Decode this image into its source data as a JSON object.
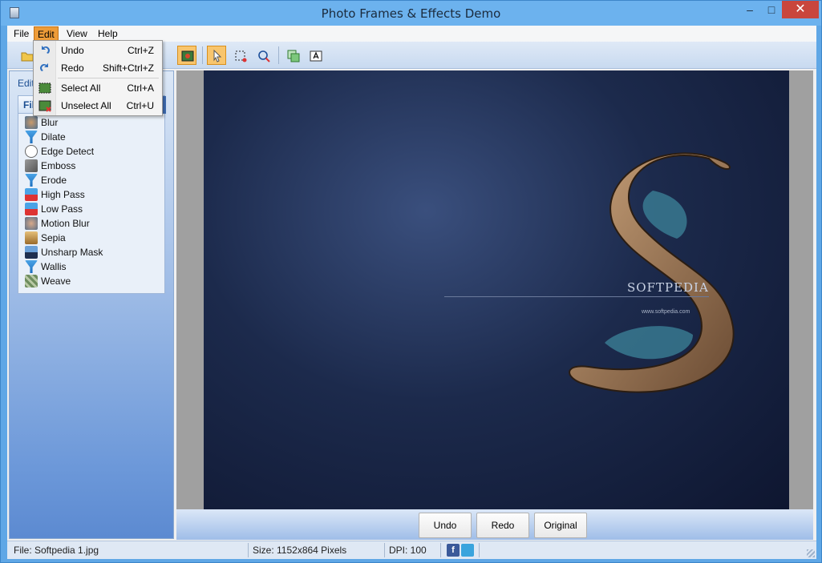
{
  "window": {
    "title": "Photo Frames & Effects Demo",
    "minimize": "–",
    "maximize": "□",
    "close": "✕"
  },
  "menubar": {
    "items": [
      {
        "label": "File"
      },
      {
        "label": "Edit"
      },
      {
        "label": "View"
      },
      {
        "label": "Help"
      }
    ]
  },
  "edit_menu": {
    "items": [
      {
        "label": "Undo",
        "shortcut": "Ctrl+Z",
        "icon": "undo-icon"
      },
      {
        "label": "Redo",
        "shortcut": "Shift+Ctrl+Z",
        "icon": "redo-icon"
      },
      {
        "label": "Select All",
        "shortcut": "Ctrl+A",
        "icon": "select-all-icon"
      },
      {
        "label": "Unselect All",
        "shortcut": "Ctrl+U",
        "icon": "unselect-all-icon"
      }
    ]
  },
  "left_panel": {
    "title": "Edit",
    "group_label": "Fil",
    "filters": [
      {
        "label": "Blur",
        "icon": "blur-icon"
      },
      {
        "label": "Dilate",
        "icon": "funnel-icon"
      },
      {
        "label": "Edge Detect",
        "icon": "edge-detect-icon"
      },
      {
        "label": "Emboss",
        "icon": "emboss-icon"
      },
      {
        "label": "Erode",
        "icon": "funnel-icon"
      },
      {
        "label": "High Pass",
        "icon": "high-pass-icon"
      },
      {
        "label": "Low Pass",
        "icon": "low-pass-icon"
      },
      {
        "label": "Motion Blur",
        "icon": "motion-blur-icon"
      },
      {
        "label": "Sepia",
        "icon": "sepia-icon"
      },
      {
        "label": "Unsharp Mask",
        "icon": "unsharp-mask-icon"
      },
      {
        "label": "Wallis",
        "icon": "funnel-icon"
      },
      {
        "label": "Weave",
        "icon": "weave-icon"
      }
    ]
  },
  "image": {
    "watermark": "SOFTPEDIA",
    "url_text": "www.softpedia.com"
  },
  "actions": {
    "undo": "Undo",
    "redo": "Redo",
    "original": "Original"
  },
  "status": {
    "file": "File: Softpedia 1.jpg",
    "size": "Size: 1152x864 Pixels",
    "dpi": "DPI: 100",
    "facebook": "f"
  },
  "colors": {
    "title_bar": "#6cb2ee",
    "menu_highlight": "#ee9c38",
    "close_button": "#c9463d",
    "panel_gradient_bottom": "#5c8ad1"
  }
}
